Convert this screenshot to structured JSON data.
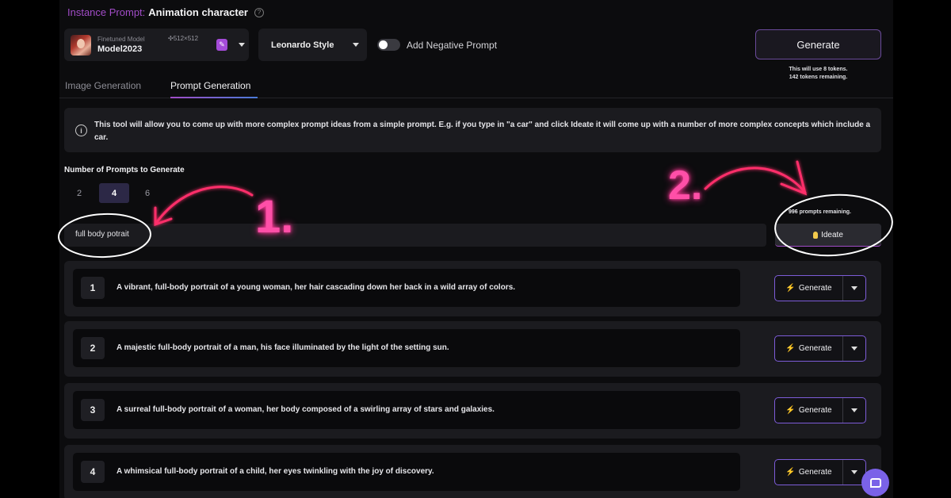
{
  "header": {
    "instance_label": "Instance Prompt:",
    "instance_value": "Animation character",
    "help_icon": "?"
  },
  "model": {
    "caption": "Finetuned Model",
    "name": "Model2023",
    "size": "✣512×512",
    "edit_icon": "edit-icon"
  },
  "style_select": {
    "value": "Leonardo Style"
  },
  "negative_prompt": {
    "label": "Add Negative Prompt",
    "enabled": false
  },
  "generate": {
    "label": "Generate",
    "tokens_line1": "This will use 8 tokens.",
    "tokens_line2": "142 tokens remaining."
  },
  "tabs": [
    {
      "label": "Image Generation",
      "active": false
    },
    {
      "label": "Prompt Generation",
      "active": true
    }
  ],
  "info": {
    "icon": "i",
    "text": "This tool will allow you to come up with more complex prompt ideas from a simple prompt. E.g. if you type in \"a car\" and click Ideate it will come up with a number of more complex concepts which include a car."
  },
  "num_prompts": {
    "label": "Number of Prompts to Generate",
    "options": [
      "2",
      "4",
      "6"
    ],
    "selected": "4"
  },
  "prompt_input": {
    "value": "full body potrait"
  },
  "ideate": {
    "label": "Ideate",
    "remaining": "996 prompts remaining."
  },
  "results": [
    {
      "num": "1",
      "text": "A vibrant, full-body portrait of a young woman, her hair cascading down her back in a wild array of colors.",
      "button": "Generate"
    },
    {
      "num": "2",
      "text": "A majestic full-body portrait of a man, his face illuminated by the light of the setting sun.",
      "button": "Generate"
    },
    {
      "num": "3",
      "text": "A surreal full-body portrait of a woman, her body composed of a swirling array of stars and galaxies.",
      "button": "Generate"
    },
    {
      "num": "4",
      "text": "A whimsical full-body portrait of a child, her eyes twinkling with the joy of discovery.",
      "button": "Generate"
    }
  ],
  "annotations": {
    "step1": "1.",
    "step2": "2.",
    "color": "#ff4fa8"
  },
  "colors": {
    "accent_purple": "#a14cc7",
    "button_border": "#7d5cd8",
    "chat": "#7a62e8"
  }
}
